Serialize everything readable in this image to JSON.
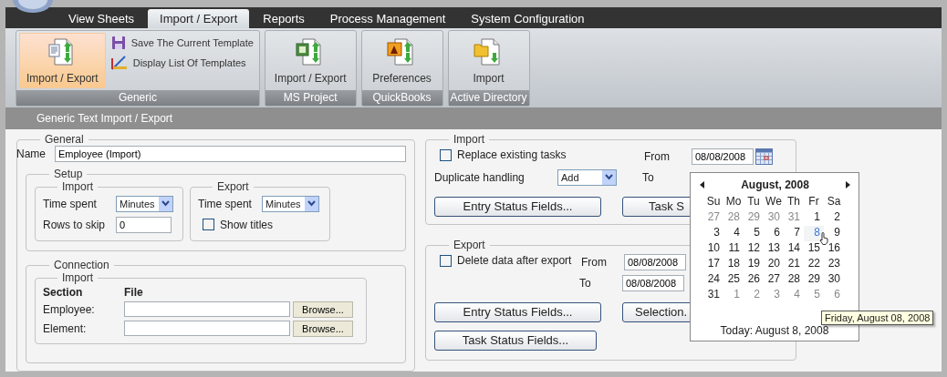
{
  "app_tabs": [
    {
      "label": "View Sheets",
      "selected": false
    },
    {
      "label": "Import / Export",
      "selected": true
    },
    {
      "label": "Reports",
      "selected": false
    },
    {
      "label": "Process Management",
      "selected": false
    },
    {
      "label": "System Configuration",
      "selected": false
    }
  ],
  "ribbon": {
    "groups": [
      {
        "title": "Generic",
        "large": [
          {
            "label": "Import / Export",
            "kind": "document",
            "selected": true
          }
        ],
        "small": [
          {
            "label": "Save The Current Template",
            "kind": "floppy"
          },
          {
            "label": "Display List Of Templates",
            "kind": "ruler"
          }
        ]
      },
      {
        "title": "MS Project",
        "large": [
          {
            "label": "Import / Export",
            "kind": "project",
            "selected": false
          }
        ]
      },
      {
        "title": "QuickBooks",
        "large": [
          {
            "label": "Preferences",
            "kind": "preferences",
            "selected": false
          }
        ]
      },
      {
        "title": "Active Directory",
        "large": [
          {
            "label": "Import",
            "kind": "folder",
            "selected": false
          }
        ]
      }
    ]
  },
  "section_title": "Generic Text Import / Export",
  "general": {
    "legend": "General",
    "name_label": "Name",
    "name_value": "Employee (Import)",
    "setup": {
      "legend": "Setup",
      "import": {
        "legend": "Import",
        "time_label": "Time spent",
        "time_value": "Minutes",
        "rows_label": "Rows to skip",
        "rows_value": "0"
      },
      "export": {
        "legend": "Export",
        "time_label": "Time spent",
        "time_value": "Minutes",
        "show_titles": {
          "label": "Show titles",
          "checked": false
        }
      }
    },
    "connection": {
      "legend": "Connection",
      "import": {
        "legend": "Import",
        "col_section": "Section",
        "col_file": "File",
        "rows": [
          {
            "section": "Employee:",
            "button": "Browse..."
          },
          {
            "section": "Element:",
            "button": "Browse..."
          }
        ]
      }
    }
  },
  "import": {
    "legend": "Import",
    "replace": {
      "label": "Replace existing tasks",
      "checked": false
    },
    "from_label": "From",
    "from_value": "08/08/2008",
    "duplicate_label": "Duplicate handling",
    "duplicate_value": "Add",
    "to_label": "To",
    "buttons": [
      "Entry Status Fields...",
      "Task S"
    ]
  },
  "export": {
    "legend": "Export",
    "delete": {
      "label": "Delete data after export",
      "checked": false
    },
    "from_label": "From",
    "from_value": "08/08/2008",
    "to_label": "To",
    "to_value": "08/08/2008",
    "buttons": [
      "Entry Status Fields...",
      "Selection.",
      "Task Status Fields..."
    ]
  },
  "calendar": {
    "title": "August, 2008",
    "weekdays": [
      "Su",
      "Mo",
      "Tu",
      "We",
      "Th",
      "Fr",
      "Sa"
    ],
    "weeks": [
      [
        {
          "day": "27",
          "other_month": true,
          "selected": false
        },
        {
          "day": "28",
          "other_month": true,
          "selected": false
        },
        {
          "day": "29",
          "other_month": true,
          "selected": false
        },
        {
          "day": "30",
          "other_month": true,
          "selected": false
        },
        {
          "day": "31",
          "other_month": true,
          "selected": false
        },
        {
          "day": "1",
          "other_month": false,
          "selected": false
        },
        {
          "day": "2",
          "other_month": false,
          "selected": false
        }
      ],
      [
        {
          "day": "3",
          "other_month": false,
          "selected": false
        },
        {
          "day": "4",
          "other_month": false,
          "selected": false
        },
        {
          "day": "5",
          "other_month": false,
          "selected": false
        },
        {
          "day": "6",
          "other_month": false,
          "selected": false
        },
        {
          "day": "7",
          "other_month": false,
          "selected": false
        },
        {
          "day": "8",
          "other_month": false,
          "selected": true
        },
        {
          "day": "9",
          "other_month": false,
          "selected": false
        }
      ],
      [
        {
          "day": "10",
          "other_month": false,
          "selected": false
        },
        {
          "day": "11",
          "other_month": false,
          "selected": false
        },
        {
          "day": "12",
          "other_month": false,
          "selected": false
        },
        {
          "day": "13",
          "other_month": false,
          "selected": false
        },
        {
          "day": "14",
          "other_month": false,
          "selected": false
        },
        {
          "day": "15",
          "other_month": false,
          "selected": false
        },
        {
          "day": "16",
          "other_month": false,
          "selected": false
        }
      ],
      [
        {
          "day": "17",
          "other_month": false,
          "selected": false
        },
        {
          "day": "18",
          "other_month": false,
          "selected": false
        },
        {
          "day": "19",
          "other_month": false,
          "selected": false
        },
        {
          "day": "20",
          "other_month": false,
          "selected": false
        },
        {
          "day": "21",
          "other_month": false,
          "selected": false
        },
        {
          "day": "22",
          "other_month": false,
          "selected": false
        },
        {
          "day": "23",
          "other_month": false,
          "selected": false
        }
      ],
      [
        {
          "day": "24",
          "other_month": false,
          "selected": false
        },
        {
          "day": "25",
          "other_month": false,
          "selected": false
        },
        {
          "day": "26",
          "other_month": false,
          "selected": false
        },
        {
          "day": "27",
          "other_month": false,
          "selected": false
        },
        {
          "day": "28",
          "other_month": false,
          "selected": false
        },
        {
          "day": "29",
          "other_month": false,
          "selected": false
        },
        {
          "day": "30",
          "other_month": false,
          "selected": false
        }
      ],
      [
        {
          "day": "31",
          "other_month": false,
          "selected": false
        },
        {
          "day": "1",
          "other_month": true,
          "selected": false
        },
        {
          "day": "2",
          "other_month": true,
          "selected": false
        },
        {
          "day": "3",
          "other_month": true,
          "selected": false
        },
        {
          "day": "4",
          "other_month": true,
          "selected": false
        },
        {
          "day": "5",
          "other_month": true,
          "selected": false
        },
        {
          "day": "6",
          "other_month": true,
          "selected": false
        }
      ]
    ],
    "today": "Today: August 8, 2008",
    "tooltip": "Friday, August 08, 2008"
  }
}
